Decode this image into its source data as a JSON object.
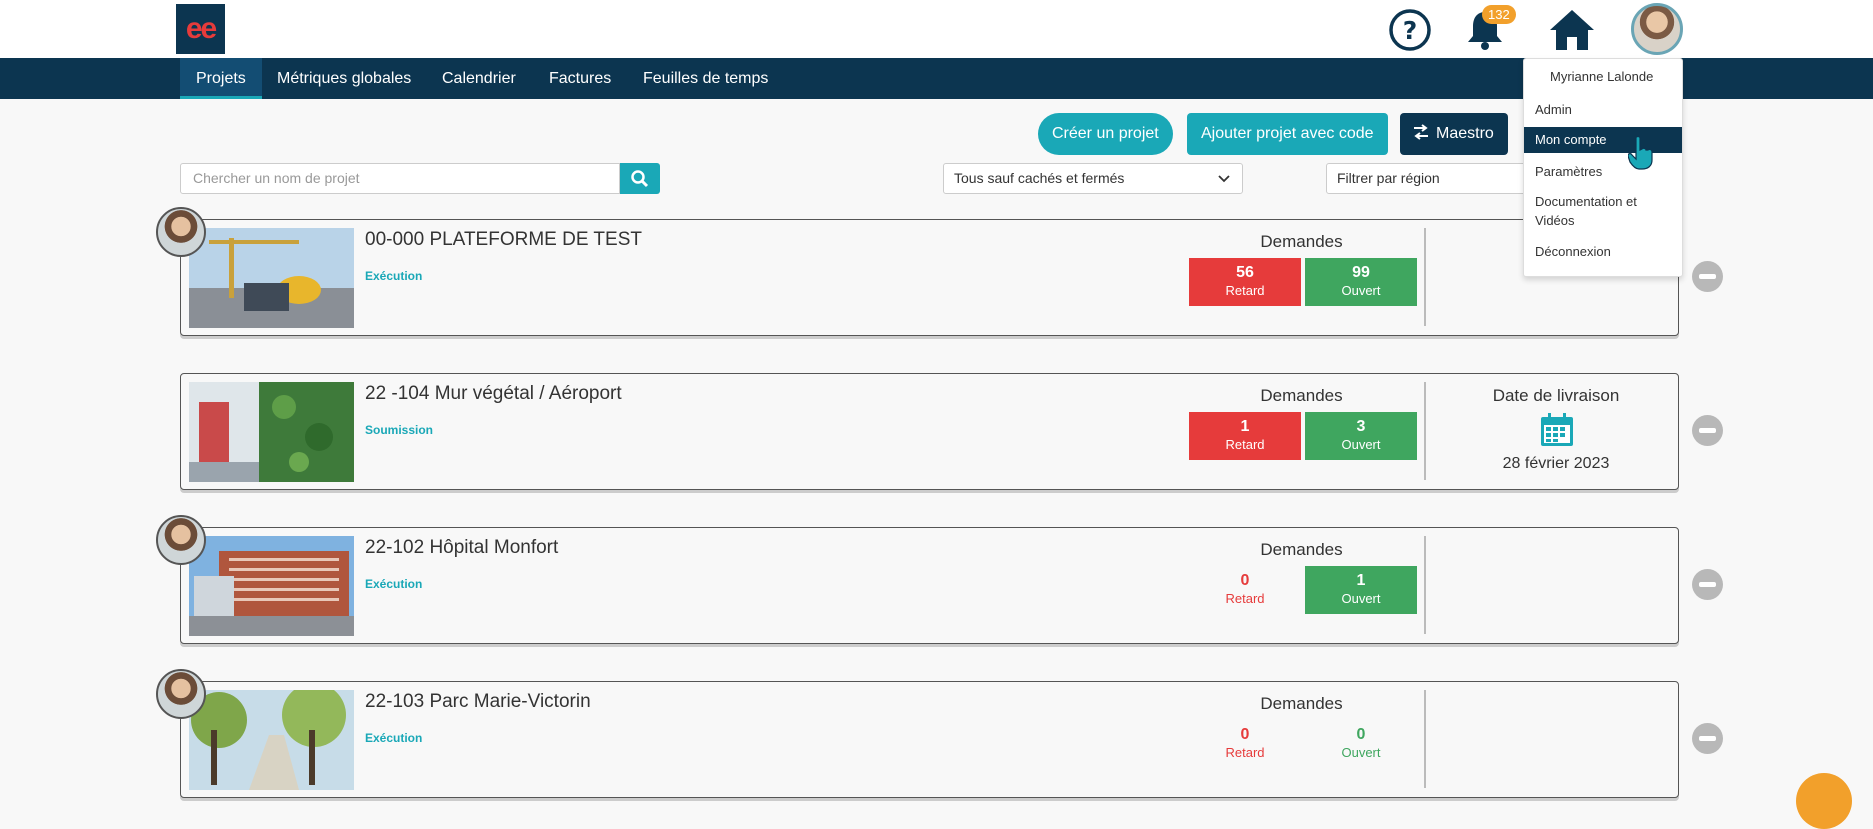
{
  "header": {
    "logo_text": "ee",
    "notification_count": "132",
    "icons": [
      "help-icon",
      "bell-icon",
      "home-icon",
      "user-avatar"
    ]
  },
  "nav": {
    "items": [
      {
        "label": "Projets",
        "active": true
      },
      {
        "label": "Métriques globales"
      },
      {
        "label": "Calendrier"
      },
      {
        "label": "Factures"
      },
      {
        "label": "Feuilles de temps"
      }
    ]
  },
  "actions": {
    "create_project": "Créer un projet",
    "add_with_code": "Ajouter projet avec code",
    "maestro": "Maestro"
  },
  "filters": {
    "search_placeholder": "Chercher un nom de projet",
    "status_filter": "Tous sauf cachés et fermés",
    "region_filter": "Filtrer par région"
  },
  "user_menu": {
    "name": "Myrianne Lalonde",
    "items": [
      "Admin",
      "Mon compte",
      "Paramètres",
      "Documentation et",
      "Vidéos",
      "Déconnexion"
    ],
    "hovered": "Mon compte"
  },
  "projects": [
    {
      "title": "00-000 PLATEFORME DE TEST",
      "phase": "Exécution",
      "demandes_label": "Demandes",
      "retard": "56",
      "retard_label": "Retard",
      "ouvert": "99",
      "ouvert_label": "Ouvert"
    },
    {
      "title": "22 -104 Mur végétal / Aéroport",
      "phase": "Soumission",
      "demandes_label": "Demandes",
      "retard": "1",
      "retard_label": "Retard",
      "ouvert": "3",
      "ouvert_label": "Ouvert",
      "livraison_label": "Date de livraison",
      "livraison_date": "28 février 2023"
    },
    {
      "title": "22-102 Hôpital Monfort",
      "phase": "Exécution",
      "demandes_label": "Demandes",
      "retard": "0",
      "retard_label": "Retard",
      "ouvert": "1",
      "ouvert_label": "Ouvert"
    },
    {
      "title": "22-103 Parc Marie-Victorin",
      "phase": "Exécution",
      "demandes_label": "Demandes",
      "retard": "0",
      "retard_label": "Retard",
      "ouvert": "0",
      "ouvert_label": "Ouvert"
    }
  ],
  "colors": {
    "navy": "#0c3550",
    "teal": "#1aa8b7",
    "red": "#e63b3b",
    "green": "#3fa65f",
    "orange": "#f2a02b"
  }
}
